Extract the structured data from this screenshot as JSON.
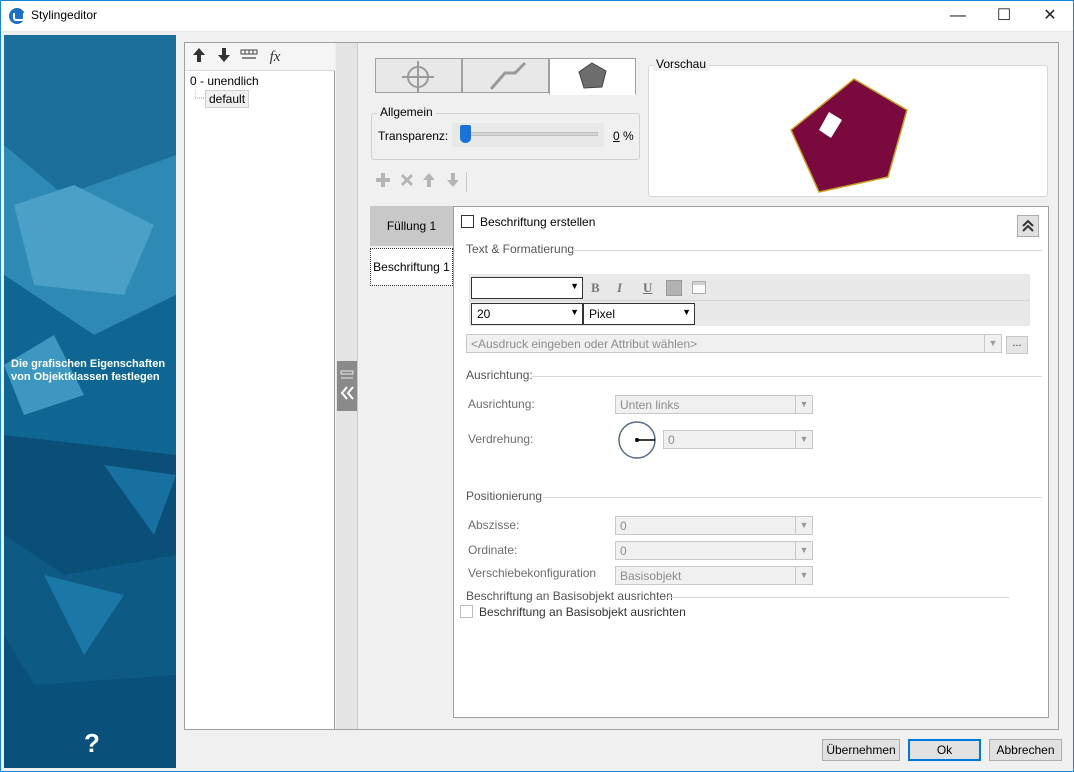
{
  "window": {
    "title": "Stylingeditor",
    "minimize_glyph": "—",
    "maximize_glyph": "☐",
    "close_glyph": "✕"
  },
  "banner": {
    "text": "Die grafischen Eigenschaften von Objektklassen festlegen",
    "help_glyph": "?"
  },
  "tree": {
    "toolbar_icons": [
      "arrow-up-icon",
      "arrow-down-icon",
      "scale-icon",
      "function-icon"
    ],
    "fx_glyph": "fx",
    "root_label": "0 - unendlich",
    "child_label": "default"
  },
  "symbol_tabs": [
    "point-symbol-icon",
    "line-symbol-icon",
    "polygon-symbol-icon"
  ],
  "allgemein": {
    "title": "Allgemein",
    "transparency_label": "Transparenz:",
    "transparency_value": "0",
    "transparency_unit": "%",
    "transparency_level": 0
  },
  "preview": {
    "title": "Vorschau",
    "fill_color": "#7a0a3e",
    "stroke_color": "#c9a227"
  },
  "layer_toolbar": [
    "add-icon",
    "delete-icon",
    "move-up-icon",
    "move-down-icon"
  ],
  "side_tabs": {
    "fill": "Füllung 1",
    "label": "Beschriftung 1"
  },
  "content": {
    "create_label_checkbox": "Beschriftung erstellen",
    "text_section": "Text & Formatierung",
    "font_value": "",
    "bold_glyph": "B",
    "italic_glyph": "I",
    "underline_glyph": "U",
    "size_value": "20",
    "unit_value": "Pixel",
    "expression_placeholder": "<Ausdruck eingeben oder Attribut wählen>",
    "ellipsis": "...",
    "alignment_section": "Ausrichtung:",
    "alignment_label": "Ausrichtung:",
    "alignment_value": "Unten links",
    "rotation_label": "Verdrehung:",
    "rotation_value": "0",
    "position_section": "Positionierung",
    "abscissa_label": "Abszisse:",
    "abscissa_value": "0",
    "ordinate_label": "Ordinate:",
    "ordinate_value": "0",
    "shift_label": "Verschiebekonfiguration",
    "shift_value": "Basisobjekt",
    "align_section": "Beschriftung an Basisobjekt ausrichten",
    "align_checkbox": "Beschriftung an Basisobjekt ausrichten"
  },
  "buttons": {
    "apply": "Übernehmen",
    "ok": "Ok",
    "cancel": "Abbrechen"
  }
}
